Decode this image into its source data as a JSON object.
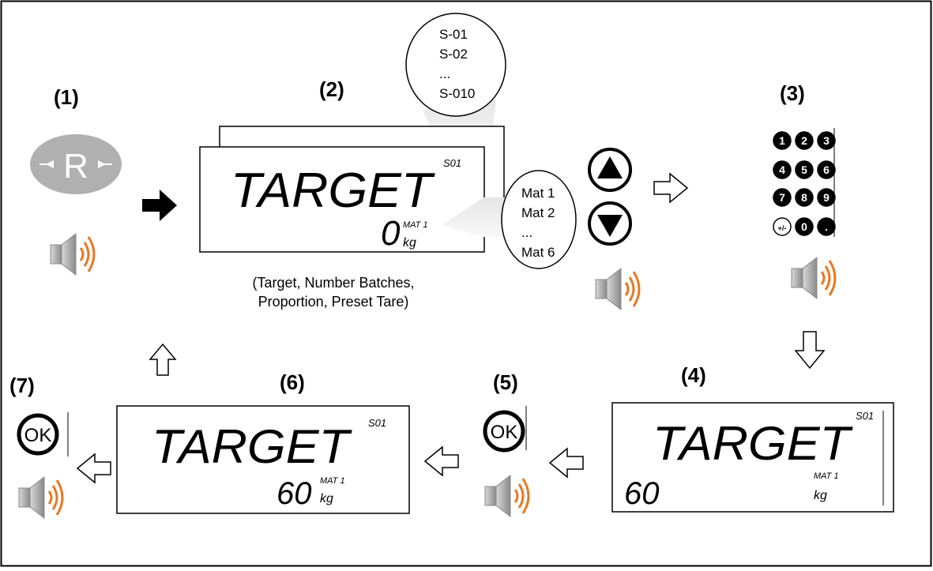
{
  "steps": [
    "(1)",
    "(2)",
    "(3)",
    "(4)",
    "(5)",
    "(6)",
    "(7)"
  ],
  "keys": {
    "r_key_label": "R",
    "ok_label": "OK",
    "keypad": [
      "1",
      "2",
      "3",
      "4",
      "5",
      "6",
      "7",
      "8",
      "9",
      "+/-",
      "0",
      "."
    ]
  },
  "displays": {
    "step2": {
      "text": "TARGET",
      "value": "0",
      "unit": "kg",
      "setpoint": "S01",
      "material": "MAT 1"
    },
    "step4": {
      "text": "TARGET",
      "value": "60",
      "unit": "kg",
      "setpoint": "S01",
      "material": "MAT 1"
    },
    "step6": {
      "text": "TARGET",
      "value": "60",
      "unit": "kg",
      "setpoint": "S01",
      "material": "MAT 1"
    }
  },
  "setpoint_bubble": [
    "S-01",
    "S-02",
    "...",
    "S-010"
  ],
  "material_bubble": [
    "Mat 1",
    "Mat 2",
    "...",
    "Mat 6"
  ],
  "caption": {
    "line1": "(Target, Number Batches,",
    "line2": "Proportion, Preset Tare)"
  },
  "icons": {
    "speaker": "speaker-icon",
    "arrow_solid": "arrow-right-solid-icon",
    "arrow_outline": "arrow-outline-icon",
    "up": "triangle-up-button-icon",
    "down": "triangle-down-button-icon"
  },
  "colors": {
    "sound_waves": "#e87722",
    "r_key": "#b0b0b0",
    "speaker_grey": "#a8a8a8"
  }
}
